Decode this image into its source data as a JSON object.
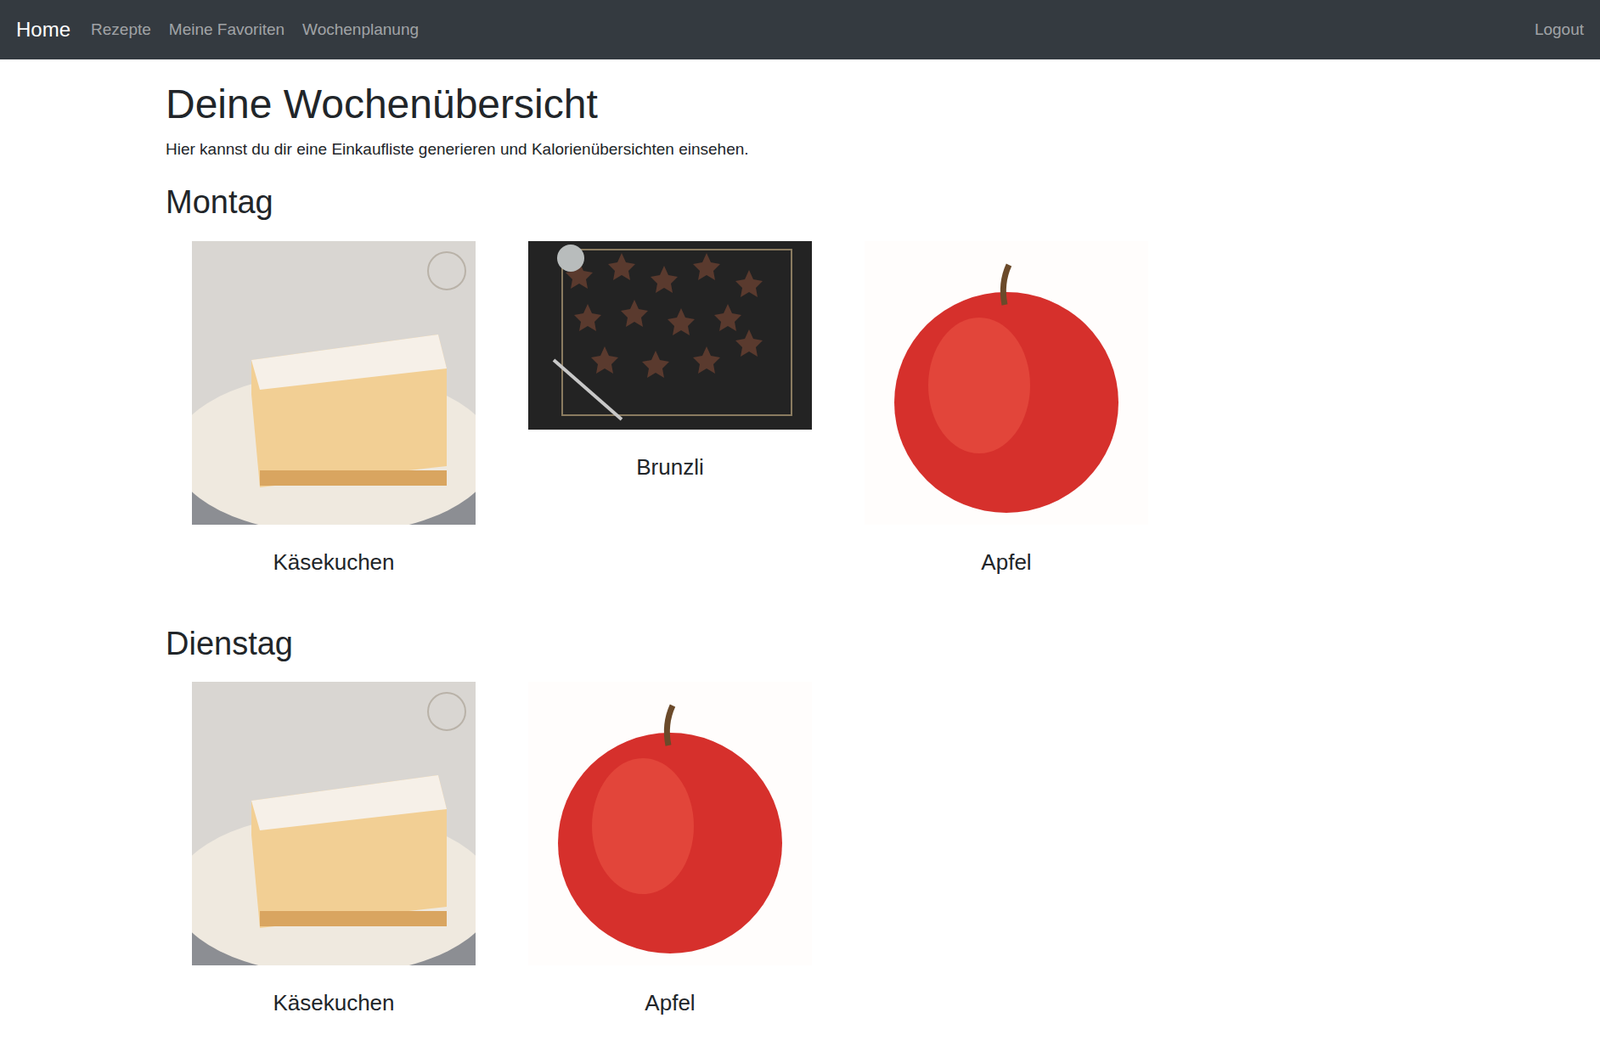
{
  "navbar": {
    "brand": "Home",
    "links": [
      "Rezepte",
      "Meine Favoriten",
      "Wochenplanung"
    ],
    "logout": "Logout"
  },
  "page": {
    "title": "Deine Wochenübersicht",
    "intro": "Hier kannst du dir eine Einkaufliste generieren und Kalorienübersichten einsehen."
  },
  "days": [
    {
      "name": "Montag",
      "recipes": [
        {
          "name": "Käsekuchen",
          "kind": "cake"
        },
        {
          "name": "Brunzli",
          "kind": "cookies"
        },
        {
          "name": "Apfel",
          "kind": "fruit"
        }
      ]
    },
    {
      "name": "Dienstag",
      "recipes": [
        {
          "name": "Käsekuchen",
          "kind": "cake"
        },
        {
          "name": "Apfel",
          "kind": "fruit"
        }
      ]
    }
  ]
}
